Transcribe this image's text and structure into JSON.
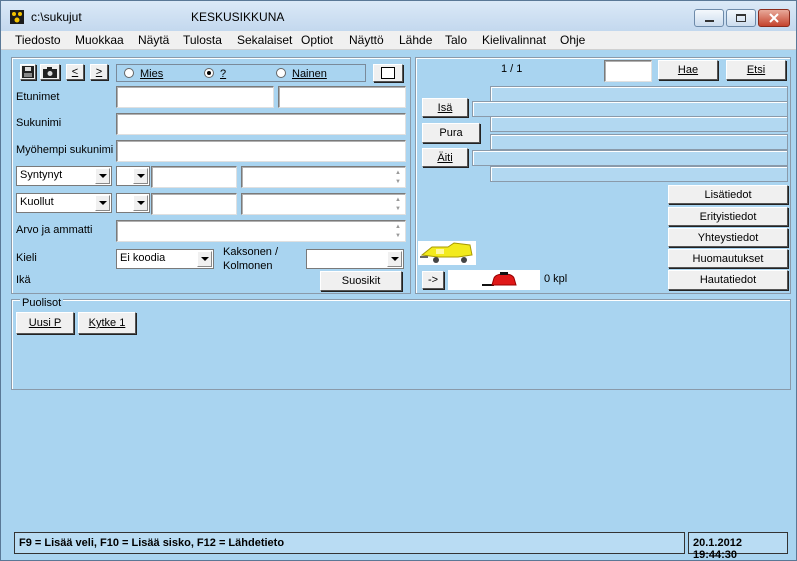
{
  "window": {
    "path": "c:\\sukujut",
    "title": "KESKUSIKKUNA"
  },
  "menu": [
    "Tiedosto",
    "Muokkaa",
    "Näytä",
    "Tulosta",
    "Sekalaiset",
    "Optiot",
    "Näyttö",
    "Lähde",
    "Talo",
    "Kielivalinnat",
    "Ohje"
  ],
  "toolbar": {
    "prev_label": "<",
    "next_label": ">",
    "gender_male": "Mies",
    "gender_unknown": "?",
    "gender_female": "Nainen",
    "selected_gender": "?"
  },
  "person": {
    "firstname_label": "Etunimet",
    "surname_label": "Sukunimi",
    "later_surname_label": "Myöhempi sukunimi",
    "born_option": "Syntynyt",
    "died_option": "Kuollut",
    "occupation_label": "Arvo ja ammatti",
    "language_label": "Kieli",
    "language_value": "Ei koodia",
    "twin_label_1": "Kaksonen /",
    "twin_label_2": "Kolmonen",
    "age_label": "Ikä",
    "favorites_button": "Suosikit"
  },
  "right": {
    "record_counter": "1 / 1",
    "fetch_button": "Hae",
    "search_button": "Etsi",
    "father_button": "Isä",
    "separate_button": "Pura",
    "mother_button": "Äiti",
    "extra_info_button": "Lisätiedot",
    "special_info_button": "Erityistiedot",
    "contact_info_button": "Yhteystiedot",
    "notes_button": "Huomautukset",
    "burial_info_button": "Hautatiedot",
    "arrow_button": "->",
    "count_text": "0 kpl"
  },
  "spouses": {
    "section_label": "Puolisot",
    "new_button": "Uusi P",
    "link_button": "Kytke 1"
  },
  "status": {
    "hint": "F9 = Lisää veli, F10 = Lisää sisko, F12 = Lähdetieto",
    "datetime": "20.1.2012 19:44:30"
  }
}
